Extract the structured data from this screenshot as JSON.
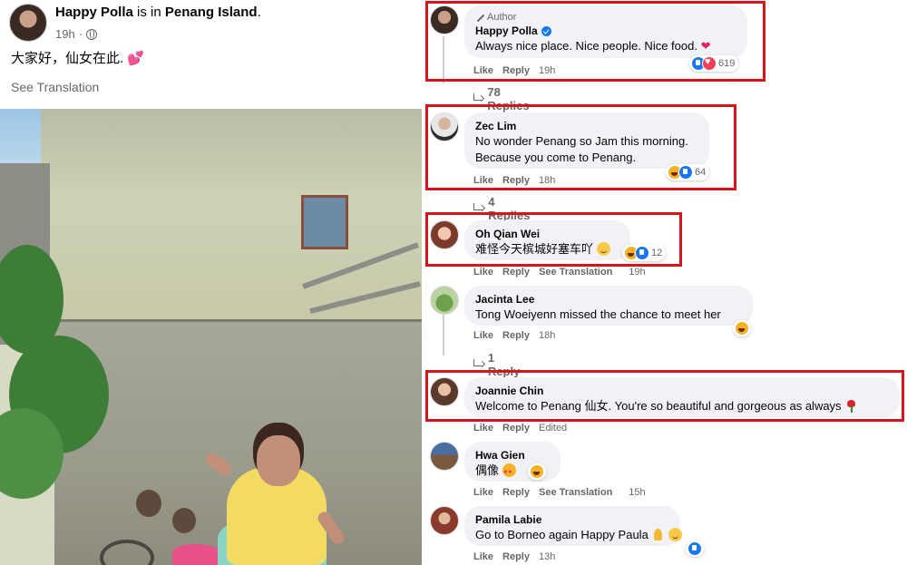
{
  "post": {
    "author": "Happy Polla",
    "location_prefix": "is in",
    "location": "Penang Island",
    "time": "19h",
    "text": "大家好，仙女在此.",
    "text_emoji": "💕",
    "see_translation": "See Translation"
  },
  "labels": {
    "like": "Like",
    "reply": "Reply",
    "see_translation": "See Translation",
    "edited": "Edited",
    "author_badge": "Author"
  },
  "comments": [
    {
      "name": "Happy Polla",
      "text": "Always nice place. Nice people. Nice food.",
      "time": "19h",
      "reaction_count": "619",
      "replies": "78 Replies"
    },
    {
      "name": "Zec Lim",
      "text_line1": "No wonder Penang so Jam this morning.",
      "text_line2": "Because you come to Penang.",
      "time": "18h",
      "reaction_count": "64",
      "replies": "4 Replies"
    },
    {
      "name": "Oh Qian Wei",
      "text": "难怪今天槟城好塞车吖",
      "time": "19h",
      "reaction_count": "12"
    },
    {
      "name": "Jacinta Lee",
      "text": "Tong Woeiyenn missed the chance to meet her",
      "time": "18h",
      "replies": "1 Reply"
    },
    {
      "name": "Joannie Chin",
      "text": "Welcome to Penang 仙女. You're so beautiful and gorgeous as always"
    },
    {
      "name": "Hwa Gien",
      "text": "偶像",
      "time": "15h"
    },
    {
      "name": "Pamila Labie",
      "text": "Go to Borneo again Happy Paula",
      "time": "13h"
    }
  ],
  "colors": {
    "highlight": "#d8131c",
    "bubble": "#f0f2f5",
    "meta_text": "#65676b",
    "like_blue": "#1877f2",
    "love_red": "#f33e58",
    "haha_yellow": "#f7b125"
  }
}
